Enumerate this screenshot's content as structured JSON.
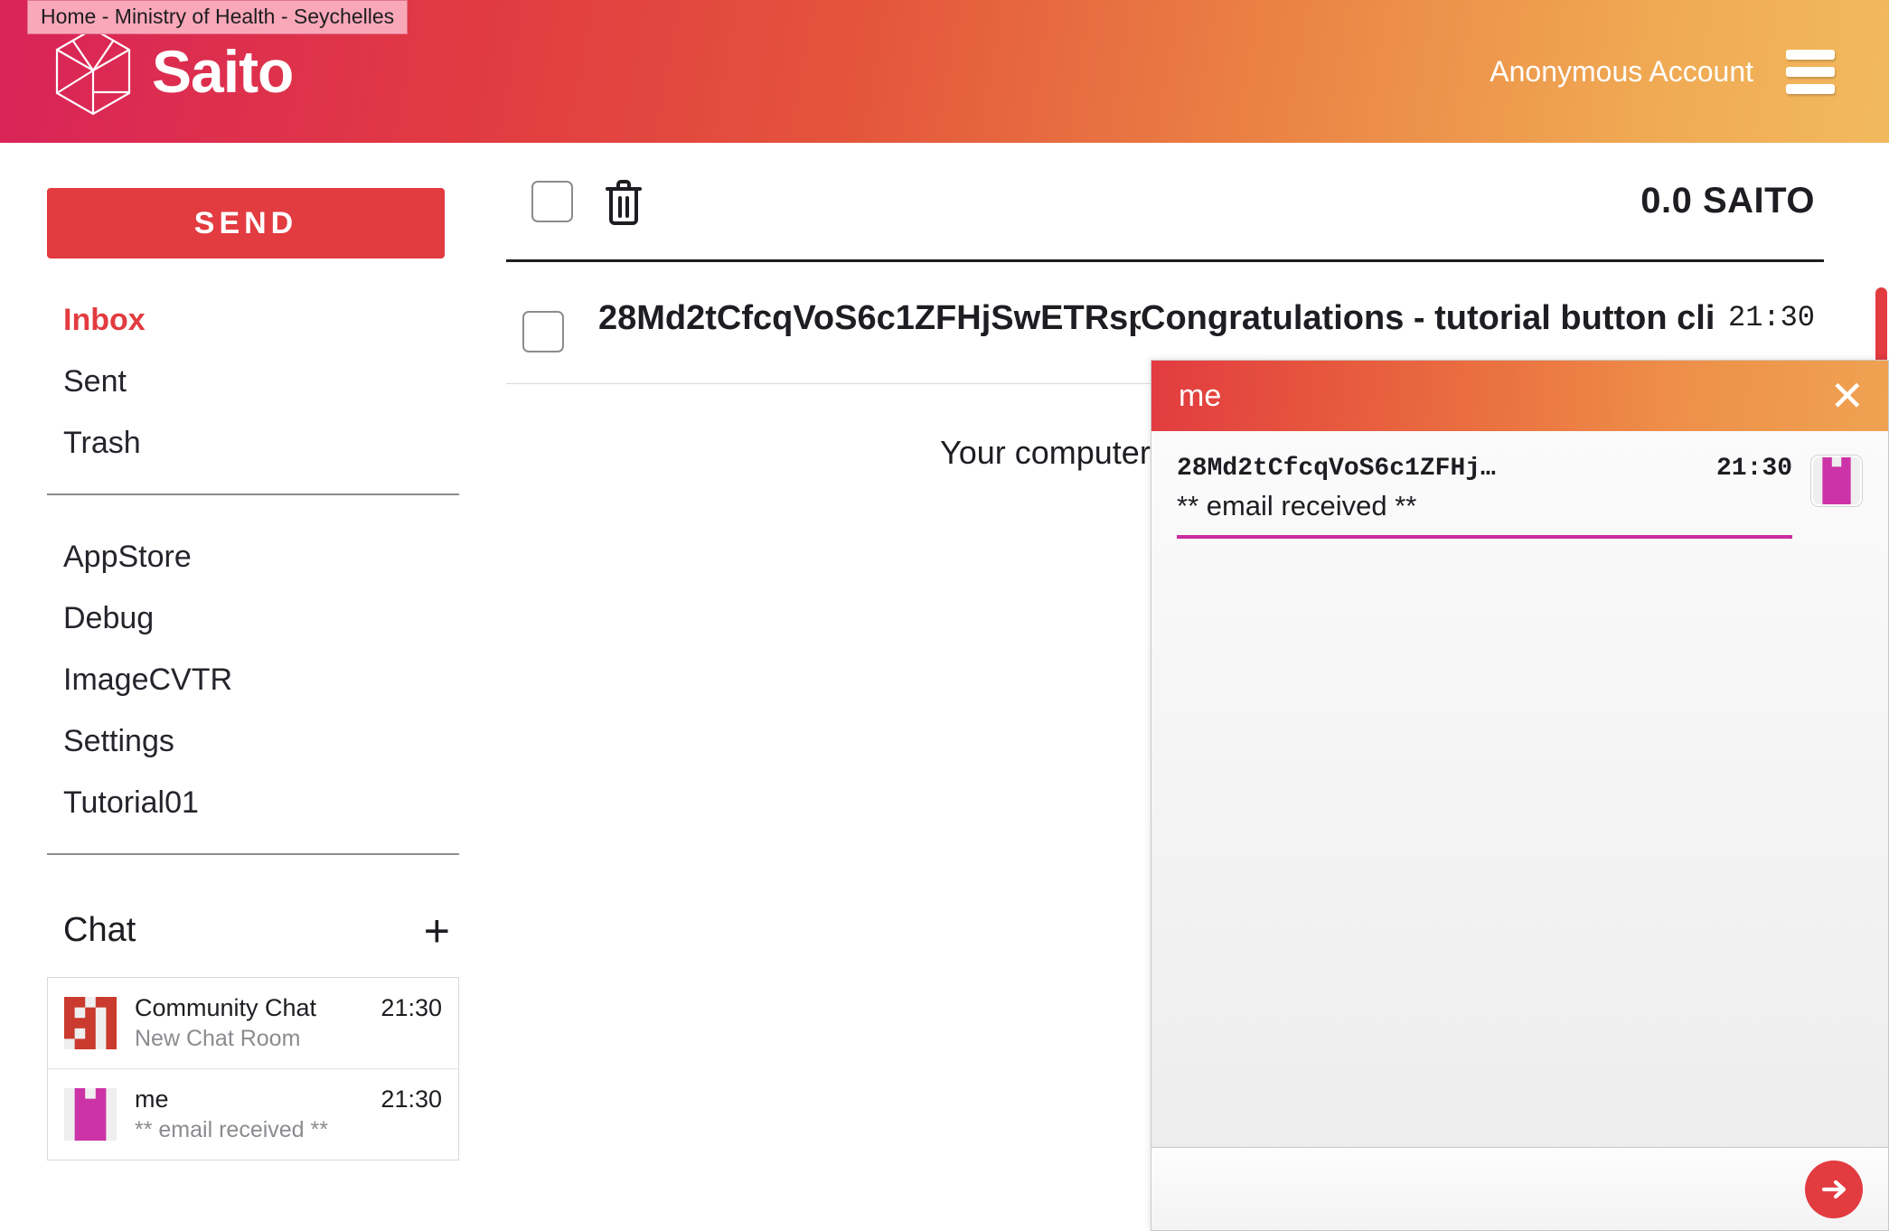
{
  "header": {
    "site_badge": "Home - Ministry of Health - Seychelles",
    "brand_name": "Saito",
    "account_label": "Anonymous Account",
    "logo_icon": "cube-logo-icon",
    "menu_icon": "hamburger-menu-icon"
  },
  "sidebar": {
    "send_label": "SEND",
    "mail_folders": [
      {
        "label": "Inbox",
        "active": true
      },
      {
        "label": "Sent",
        "active": false
      },
      {
        "label": "Trash",
        "active": false
      }
    ],
    "modules": [
      {
        "label": "AppStore"
      },
      {
        "label": "Debug"
      },
      {
        "label": "ImageCVTR"
      },
      {
        "label": "Settings"
      },
      {
        "label": "Tutorial01"
      }
    ],
    "chat": {
      "title": "Chat",
      "add_icon": "plus-icon",
      "rooms": [
        {
          "name": "Community Chat",
          "preview": "New Chat Room",
          "time": "21:30",
          "avatar_icon": "identicon-avatar",
          "avatar_color": "#cb3a2e",
          "avatar_bits": "1101110101111011010101101"
        },
        {
          "name": "me",
          "preview": "** email received **",
          "time": "21:30",
          "avatar_icon": "identicon-avatar",
          "avatar_color": "#cc33a6",
          "avatar_bits": "0101001110011100111001110"
        }
      ]
    }
  },
  "mail": {
    "toolbar": {
      "select_all_icon": "checkbox-icon",
      "delete_icon": "trash-icon",
      "balance": "0.0 SAITO"
    },
    "rows": [
      {
        "checkbox_icon": "checkbox-icon",
        "from": "28Md2tCfcqVoS6c1ZFHjSwETRspp...",
        "subject": "Congratulations - tutorial button click...",
        "preview": "Your computer attached this email to a",
        "time": "21:30"
      }
    ]
  },
  "chat_popup": {
    "title": "me",
    "close_icon": "close-icon",
    "send_icon": "arrow-right-icon",
    "messages": [
      {
        "author_id": "28Md2tCfcqVoS6c1ZFHj…",
        "time": "21:30",
        "text": "** email received **",
        "avatar_icon": "identicon-avatar",
        "avatar_color": "#cc33a6",
        "avatar_bits": "0101001110011100111001110"
      }
    ]
  },
  "scrollbar": {
    "thumb_icon": "scrollbar-thumb"
  },
  "colors": {
    "accent_red": "#e23b40",
    "accent_orange": "#efa252",
    "magenta": "#c92ba0",
    "identicon_red": "#cb3a2e",
    "identicon_magenta": "#cc33a6"
  }
}
